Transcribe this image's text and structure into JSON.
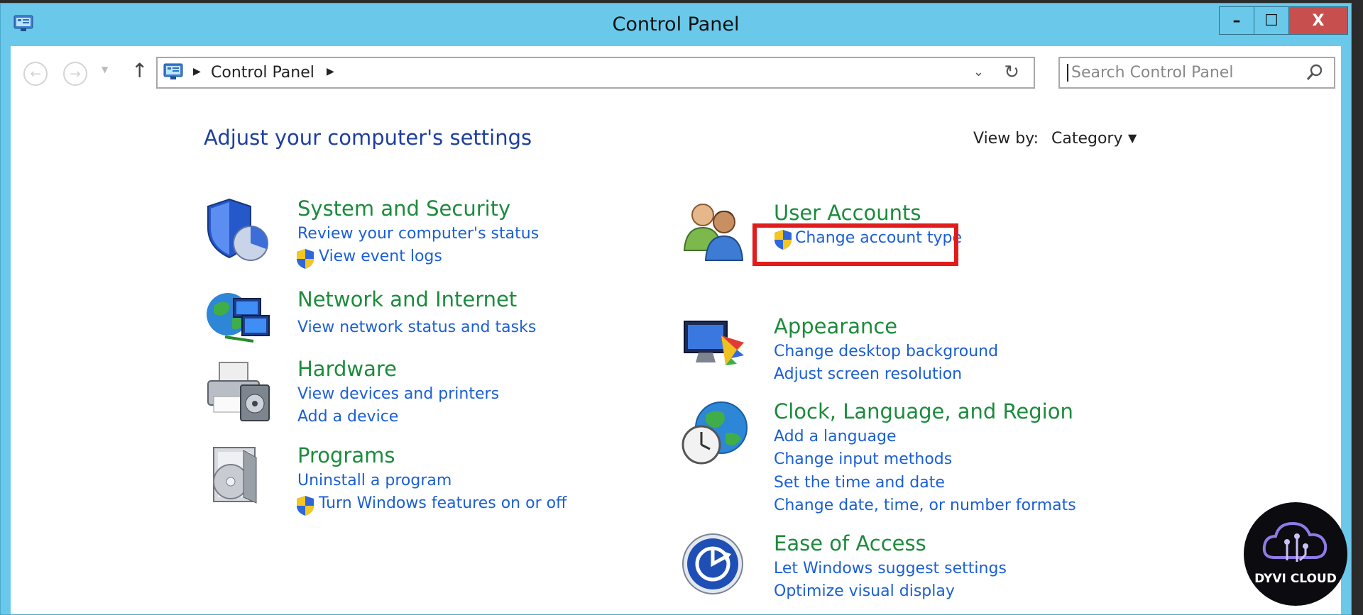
{
  "window": {
    "title": "Control Panel",
    "controls": {
      "minimize": "–",
      "maximize": "☐",
      "close": "X"
    }
  },
  "nav": {
    "back": "←",
    "forward": "→",
    "up": "↑",
    "breadcrumb": [
      "Control Panel"
    ],
    "search_placeholder": "Search Control Panel"
  },
  "main": {
    "heading": "Adjust your computer's settings",
    "view_by_label": "View by:",
    "view_by_value": "Category"
  },
  "categories": {
    "system_security": {
      "title": "System and Security",
      "links": [
        "Review your computer's status",
        "View event logs"
      ]
    },
    "network": {
      "title": "Network and Internet",
      "links": [
        "View network status and tasks"
      ]
    },
    "hardware": {
      "title": "Hardware",
      "links": [
        "View devices and printers",
        "Add a device"
      ]
    },
    "programs": {
      "title": "Programs",
      "links": [
        "Uninstall a program",
        "Turn Windows features on or off"
      ]
    },
    "user_accounts": {
      "title": "User Accounts",
      "links": [
        "Change account type"
      ]
    },
    "appearance": {
      "title": "Appearance",
      "links": [
        "Change desktop background",
        "Adjust screen resolution"
      ]
    },
    "clock": {
      "title": "Clock, Language, and Region",
      "links": [
        "Add a language",
        "Change input methods",
        "Set the time and date",
        "Change date, time, or number formats"
      ]
    },
    "ease": {
      "title": "Ease of Access",
      "links": [
        "Let Windows suggest settings",
        "Optimize visual display"
      ]
    }
  },
  "watermark": {
    "text": "DYVI CLOUD"
  },
  "colors": {
    "titlebar": "#6ac9ea",
    "category_title": "#1c8b3c",
    "link": "#1b5fd6",
    "heading": "#1e3f9f",
    "highlight": "#e11c1c",
    "close_button": "#c7504f"
  }
}
